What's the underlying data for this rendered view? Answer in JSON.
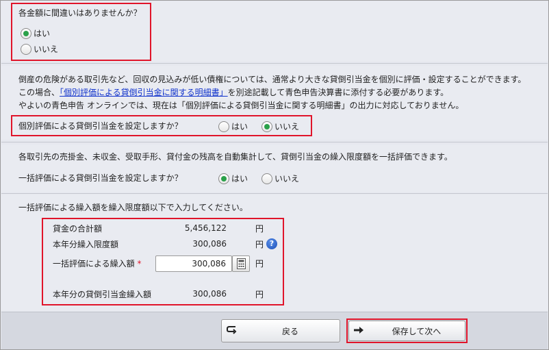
{
  "section1": {
    "question": "各金額に間違いはありませんか？",
    "options": [
      {
        "label": "はい",
        "selected": true
      },
      {
        "label": "いいえ",
        "selected": false
      }
    ]
  },
  "section2": {
    "line1": "倒産の危険がある取引先など、回収の見込みが低い債権については、通常より大きな貸倒引当金を個別に評価・設定することができます。",
    "line2_prefix": "この場合、",
    "line2_link": "「個別評価による貸倒引当金に関する明細書」",
    "line2_suffix": "を別途記載して青色申告決算書に添付する必要があります。",
    "line3": "やよいの青色申告 オンラインでは、現在は「個別評価による貸倒引当金に関する明細書」の出力に対応しておりません。",
    "question": "個別評価による貸倒引当金を設定しますか？",
    "yes_label": "はい",
    "no_label": "いいえ",
    "yes_selected": false,
    "no_selected": true
  },
  "section3": {
    "description": "各取引先の売掛金、未収金、受取手形、貸付金の残高を自動集計して、貸倒引当金の繰入限度額を一括評価できます。",
    "question": "一括評価による貸倒引当金を設定しますか？",
    "yes_label": "はい",
    "no_label": "いいえ",
    "yes_selected": true,
    "no_selected": false
  },
  "section4": {
    "instruction": "一括評価による繰入額を繰入限度額以下で入力してください。",
    "rows": {
      "loan_total": {
        "label": "貸金の合計額",
        "value": "5,456,122",
        "unit": "円"
      },
      "limit": {
        "label": "本年分繰入限度額",
        "value": "300,086",
        "unit": "円"
      },
      "input": {
        "label": "一括評価による繰入額",
        "required_mark": "*",
        "value": "300,086",
        "unit": "円"
      },
      "result": {
        "label": "本年分の貸倒引当金繰入額",
        "value": "300,086",
        "unit": "円"
      }
    },
    "help_glyph": "?"
  },
  "footer": {
    "back_label": "戻る",
    "next_label": "保存して次へ"
  },
  "colors": {
    "highlight_border": "#e0142a",
    "radio_selected": "#2aa14a",
    "link": "#1133cc"
  }
}
